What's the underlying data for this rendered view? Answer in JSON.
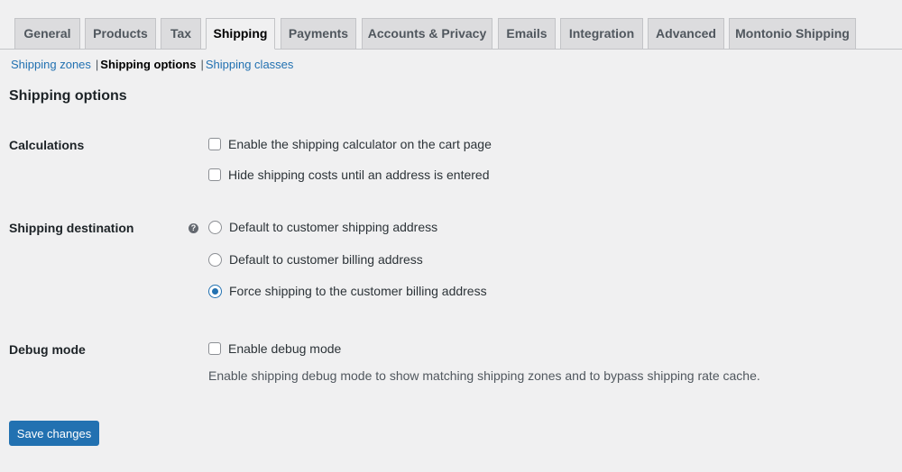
{
  "tabs": [
    {
      "label": "General"
    },
    {
      "label": "Products"
    },
    {
      "label": "Tax"
    },
    {
      "label": "Shipping",
      "active": true
    },
    {
      "label": "Payments"
    },
    {
      "label": "Accounts & Privacy"
    },
    {
      "label": "Emails"
    },
    {
      "label": "Integration"
    },
    {
      "label": "Advanced"
    },
    {
      "label": "Montonio Shipping"
    }
  ],
  "subnav": {
    "zones": "Shipping zones",
    "separator": "|",
    "options": "Shipping options",
    "classes": "Shipping classes"
  },
  "page_title": "Shipping options",
  "calculations": {
    "label": "Calculations",
    "enable_calculator": {
      "label": "Enable the shipping calculator on the cart page",
      "checked": false
    },
    "hide_costs": {
      "label": "Hide shipping costs until an address is entered",
      "checked": false
    }
  },
  "destination": {
    "label": "Shipping destination",
    "help_icon": "help-icon",
    "help_glyph": "?",
    "options": [
      {
        "label": "Default to customer shipping address",
        "checked": false
      },
      {
        "label": "Default to customer billing address",
        "checked": false
      },
      {
        "label": "Force shipping to the customer billing address",
        "checked": true
      }
    ]
  },
  "debug": {
    "label": "Debug mode",
    "enable": {
      "label": "Enable debug mode",
      "checked": false
    },
    "description": "Enable shipping debug mode to show matching shipping zones and to bypass shipping rate cache."
  },
  "save_button": "Save changes",
  "colors": {
    "accent": "#2271b1",
    "background": "#f0f0f1",
    "tab_inactive": "#dcdcde"
  }
}
